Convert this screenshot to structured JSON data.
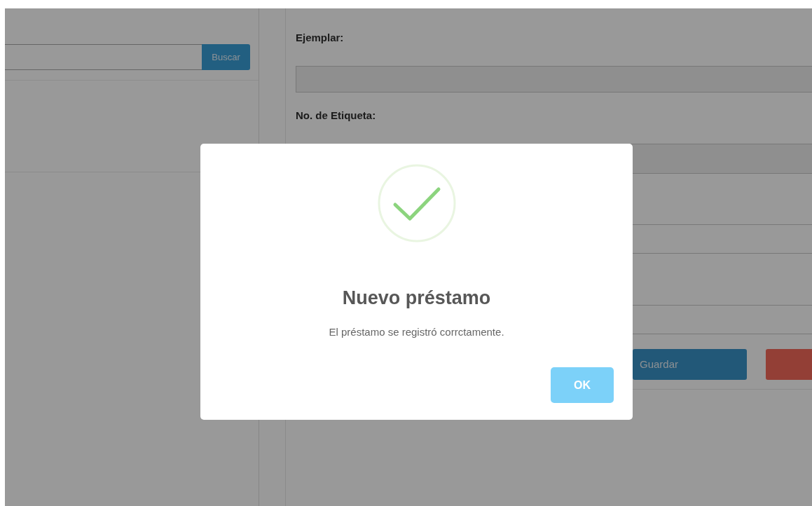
{
  "search": {
    "button": "Buscar"
  },
  "form": {
    "fields": [
      {
        "label": "Ejemplar:",
        "kind": "readonly"
      },
      {
        "label": "No. de Etiqueta:",
        "kind": "readonly"
      },
      {
        "kind": "text"
      },
      {
        "kind": "text"
      }
    ],
    "buttons": [
      {
        "label": "Guardar",
        "kind": "primary"
      },
      {
        "kind": "danger"
      }
    ]
  },
  "dialog": {
    "title": "Nuevo préstamo",
    "message": "El préstamo se registró corrctamente.",
    "button": "OK"
  }
}
